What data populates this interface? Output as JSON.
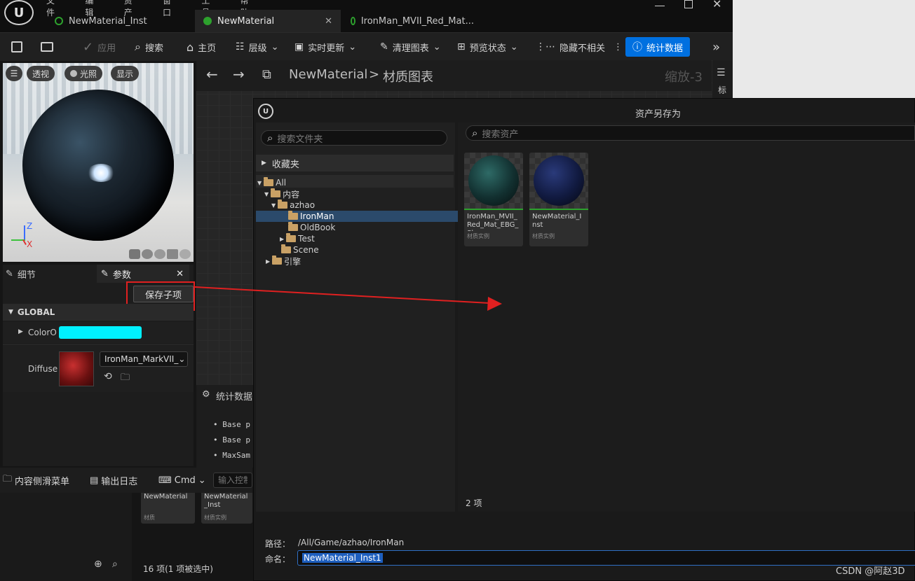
{
  "app": {
    "menu": [
      "文件",
      "编辑",
      "资产",
      "窗口",
      "工具",
      "帮助"
    ],
    "tabs": [
      {
        "label": "NewMaterial_Inst"
      },
      {
        "label": "NewMaterial"
      },
      {
        "label": "IronMan_MVII_Red_Mat..."
      }
    ]
  },
  "toolbar": {
    "apply": "应用",
    "search": "搜索",
    "home": "主页",
    "hierarchy": "层级",
    "live_update": "实时更新",
    "clean_graph": "清理图表",
    "preview_state": "预览状态",
    "hide_unrelated": "隐藏不相关",
    "stats": "统计数据"
  },
  "viewport": {
    "perspective": "透视",
    "lighting": "光照",
    "show": "显示",
    "axis_z": "Z",
    "axis_x": "X"
  },
  "details": {
    "tab_details": "细节",
    "tab_params": "参数",
    "save_child": "保存子项",
    "group": "GLOBAL",
    "color_param": "ColorO",
    "color_value": "#00f0ff",
    "diffuse_param": "Diffuse",
    "texture_select": "IronMan_MarkVII_"
  },
  "graph": {
    "asset_name": "NewMaterial",
    "sep": ">",
    "section": "材质图表",
    "zoom": "缩放-3",
    "side_label": "标"
  },
  "stats_panel": {
    "title": "统计数据",
    "lines": [
      "Base p",
      "Base p",
      "MaxSam"
    ]
  },
  "dialog": {
    "title": "资产另存为",
    "search_folders": "搜索文件夹",
    "favorites": "收藏夹",
    "search_assets": "搜索资产",
    "tree": [
      {
        "label": "All"
      },
      {
        "label": "内容"
      },
      {
        "label": "azhao"
      },
      {
        "label": "IronMan"
      },
      {
        "label": "OldBook"
      },
      {
        "label": "Test"
      },
      {
        "label": "Scene"
      },
      {
        "label": "引擎"
      }
    ],
    "assets": [
      {
        "name": "IronMan_MVII_Red_Mat_EBG_Sha...",
        "type": "材质实例"
      },
      {
        "name": "NewMaterial_Inst",
        "type": "材质实例"
      }
    ],
    "item_count": "2 项",
    "path_label": "路径：",
    "path_value": "/All/Game/azhao/IronMan",
    "name_label": "命名：",
    "name_value": "NewMaterial_Inst1"
  },
  "bottom": {
    "content_drawer": "内容侧滑菜单",
    "output_log": "输出日志",
    "cmd": "Cmd",
    "console_placeholder": "输入控制",
    "cb_assets": [
      {
        "name": "NewMaterial",
        "type": "材质"
      },
      {
        "name": "NewMaterial_Inst",
        "type": "材质实例"
      }
    ],
    "cb_count": "16 项(1 项被选中)"
  },
  "watermark": "CSDN @阿赵3D",
  "colors": {
    "accent": "#0070e0",
    "highlight_red": "#e02020",
    "selection": "#2b4a6b"
  }
}
